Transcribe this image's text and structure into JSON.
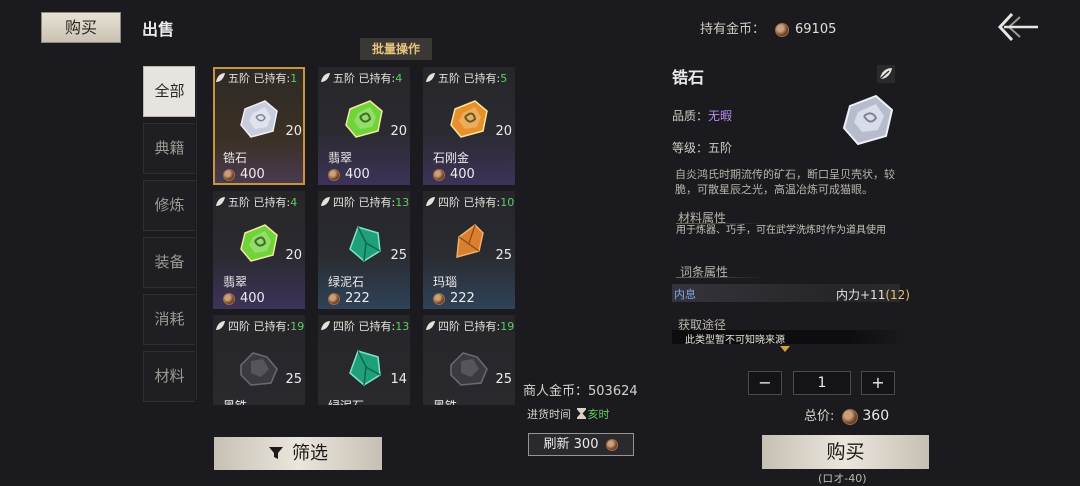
{
  "header": {
    "tab_buy": "购买",
    "tab_sell": "出售",
    "gold_label": "持有金币：",
    "gold_value": "69105",
    "bulk_label": "批量操作"
  },
  "categories": [
    "全部",
    "典籍",
    "修炼",
    "装备",
    "消耗",
    "材料"
  ],
  "items": [
    {
      "rank": "五阶",
      "owned_label": "已持有:",
      "owned": "1",
      "qty": "20",
      "name": "锆石",
      "price": "400",
      "gem": "zircon-gem-icon",
      "color": "#c8ccdc"
    },
    {
      "rank": "五阶",
      "owned_label": "已持有:",
      "owned": "4",
      "qty": "20",
      "name": "翡翠",
      "price": "400",
      "gem": "jade-gem-icon",
      "color": "#6fd33a"
    },
    {
      "rank": "五阶",
      "owned_label": "已持有:",
      "owned": "5",
      "qty": "20",
      "name": "石刚金",
      "price": "400",
      "gem": "gold-gem-icon",
      "color": "#e8902a"
    },
    {
      "rank": "五阶",
      "owned_label": "已持有:",
      "owned": "4",
      "qty": "20",
      "name": "翡翠",
      "price": "400",
      "gem": "jade-gem-icon",
      "color": "#6fd33a"
    },
    {
      "rank": "四阶",
      "owned_label": "已持有:",
      "owned": "13",
      "qty": "25",
      "name": "绿泥石",
      "price": "222",
      "gem": "chlorite-gem-icon",
      "color": "#1fa07a"
    },
    {
      "rank": "四阶",
      "owned_label": "已持有:",
      "owned": "10",
      "qty": "25",
      "name": "玛瑙",
      "price": "222",
      "gem": "agate-gem-icon",
      "color": "#d9802f"
    },
    {
      "rank": "四阶",
      "owned_label": "已持有:",
      "owned": "19",
      "qty": "25",
      "name": "黑铁",
      "price": "",
      "gem": "iron-ore-icon",
      "color": "#3a3a40"
    },
    {
      "rank": "四阶",
      "owned_label": "已持有:",
      "owned": "13",
      "qty": "14",
      "name": "绿泥石",
      "price": "",
      "gem": "chlorite-gem-icon",
      "color": "#1fa07a"
    },
    {
      "rank": "四阶",
      "owned_label": "已持有:",
      "owned": "19",
      "qty": "25",
      "name": "黑铁",
      "price": "",
      "gem": "iron-ore-icon",
      "color": "#3a3a40"
    }
  ],
  "merchant": {
    "gold_label": "商人金币：",
    "gold_value": "503624",
    "restock_label": "进货时间",
    "restock_time": "亥时",
    "refresh_label": "刷新 300"
  },
  "filter_label": "筛选",
  "detail": {
    "name": "锆石",
    "quality_label": "品质：",
    "quality_value": "无暇",
    "level_label": "等级：",
    "level_value": "五阶",
    "description": "自炎鸿氏时期流传的矿石，断口呈贝壳状，较脆，可散星辰之光，高温冶炼可成猫眼。",
    "material_title": "材料属性",
    "material_desc": "用于炼器、巧手，可在武学洗炼时作为道具使用",
    "affix_title": "词条属性",
    "affix_name": "内息",
    "affix_value": "内力+11",
    "affix_bonus": "(12)",
    "source_title": "获取途径",
    "source_text": "此类型暂不可知晓来源"
  },
  "purchase": {
    "minus": "−",
    "plus": "+",
    "quantity": "1",
    "total_label": "总价:",
    "total_value": "360",
    "buy_label": "购买",
    "buy_hint": "(ロオ-40)"
  }
}
